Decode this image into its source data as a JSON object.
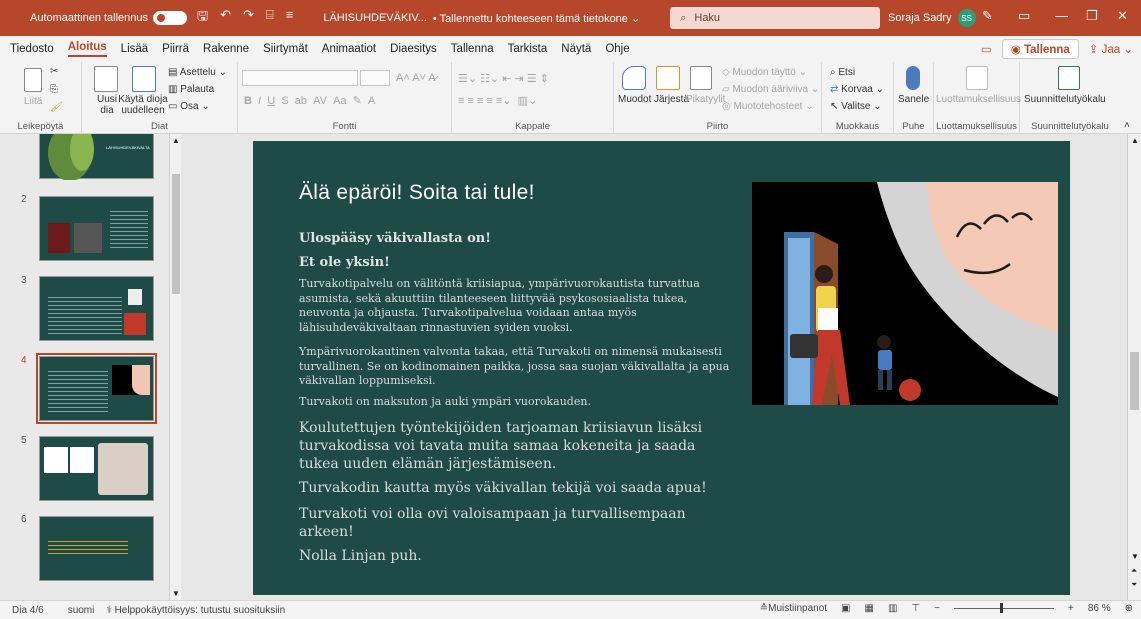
{
  "titlebar": {
    "autosave_label": "Automaattinen tallennus",
    "doc_name": "LÄHISUHDEVÄKIV...",
    "doc_status": "• Tallennettu kohteeseen tämä tietokone ⌄",
    "search_placeholder": "Haku",
    "user_name": "Soraja Sadry",
    "user_initials": "SS"
  },
  "menu": {
    "tabs": [
      "Tiedosto",
      "Aloitus",
      "Lisää",
      "Piirrä",
      "Rakenne",
      "Siirtymät",
      "Animaatiot",
      "Diaesitys",
      "Tallenna",
      "Tarkista",
      "Näytä",
      "Ohje"
    ],
    "active_tab": "Aloitus",
    "record_label": "◉ Tallenna",
    "share_label": "Jaa"
  },
  "ribbon": {
    "clipboard": {
      "paste": "Liitä",
      "label": "Leikepöytä"
    },
    "slides": {
      "new": "Uusi dia",
      "reuse": "Käytä dioja uudelleen",
      "layout": "Asettelu",
      "reset": "Palauta",
      "section": "Osa",
      "label": "Diat"
    },
    "font": {
      "label": "Fontti"
    },
    "paragraph": {
      "label": "Kappale"
    },
    "drawing": {
      "shapes": "Muodot",
      "arrange": "Järjestä",
      "quick": "Pikatyylit",
      "fill": "Muodon täyttö",
      "outline": "Muodon ääriviiva",
      "effects": "Muototehosteet",
      "label": "Piirto"
    },
    "editing": {
      "find": "Etsi",
      "replace": "Korvaa",
      "select": "Valitse",
      "label": "Muokkaus"
    },
    "voice": {
      "dictate": "Sanele",
      "label": "Puhe"
    },
    "sensitivity": {
      "btn": "Luottamuksellisuus",
      "label": "Luottamuksellisuus"
    },
    "design": {
      "btn": "Suunnittelutyökalu",
      "label": "Suunnittelutyökalu"
    }
  },
  "thumbnails": [
    {
      "num": "",
      "title": "LÄHISUHDEVÄKIVALTA"
    },
    {
      "num": "2",
      "title": ""
    },
    {
      "num": "3",
      "title": ""
    },
    {
      "num": "4",
      "title": ""
    },
    {
      "num": "5",
      "title": ""
    },
    {
      "num": "6",
      "title": ""
    }
  ],
  "slide": {
    "title": "Älä epäröi! Soita tai tule!",
    "heading1": "Ulospääsy väkivallasta on!",
    "heading2": "Et ole yksin!",
    "para1": "Turvakotipalvelu on välitöntä kriisiapua, ympärivuorokautista turvattua asumista, sekä akuuttiin tilanteeseen liittyvää psykososiaalista tukea, neuvonta ja ohjausta. Turvakotipalvelua voidaan antaa myös lähisuhdeväkivaltaan rinnastuvien syiden vuoksi.",
    "para2": "Ympärivuorokautinen valvonta takaa, että Turvakoti on nimensä mukaisesti turvallinen. Se on kodinomainen paikka, jossa saa suojan väkivallalta ja apua väkivallan loppumiseksi.",
    "para3": "Turvakoti on maksuton ja auki ympäri vuorokauden.",
    "para4": "Koulutettujen työntekijöiden tarjoaman kriisiavun lisäksi turvakodissa voi tavata muita samaa kokeneita ja saada tukea uuden elämän järjestämiseen.",
    "para5": "Turvakodin kautta myös väkivallan tekijä voi saada apua!",
    "para6": "Turvakoti voi olla ovi valoisampaan ja turvallisempaan arkeen!",
    "para7": "Nolla Linjan puh."
  },
  "status": {
    "slide_count": "Dia 4/6",
    "language": "suomi",
    "accessibility": "Helppokäyttöisyys: tutustu suosituksiin",
    "notes": "Muistiinpanot",
    "zoom": "86 %"
  },
  "colors": {
    "accent": "#b7472a",
    "slide_bg": "#1f4b47"
  }
}
